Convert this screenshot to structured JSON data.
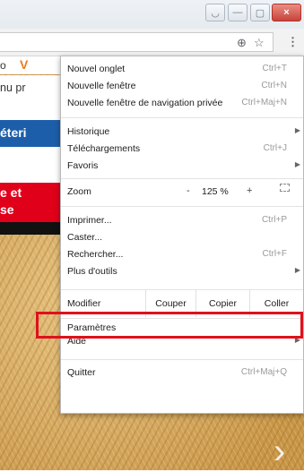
{
  "window": {
    "user_glyph": "◡",
    "min_glyph": "—",
    "max_glyph": "▢",
    "close_glyph": "×"
  },
  "toolbar": {
    "zoom_glyph": "⊕",
    "star_glyph": "☆",
    "menu_glyph": "⋮"
  },
  "page": {
    "bookmark_text": "o",
    "bookmark_icon": "V",
    "snippet": "nu pr",
    "blue_text": "éteri",
    "red_line1": "e et",
    "red_line2": "se",
    "chevron": "›"
  },
  "menu": {
    "new_tab": {
      "label": "Nouvel onglet",
      "shortcut": "Ctrl+T"
    },
    "new_window": {
      "label": "Nouvelle fenêtre",
      "shortcut": "Ctrl+N"
    },
    "new_private": {
      "label": "Nouvelle fenêtre de navigation privée",
      "shortcut": "Ctrl+Maj+N"
    },
    "history": {
      "label": "Historique",
      "arrow": "▶"
    },
    "downloads": {
      "label": "Téléchargements",
      "shortcut": "Ctrl+J"
    },
    "favorites": {
      "label": "Favoris",
      "arrow": "▶"
    },
    "zoom": {
      "label": "Zoom",
      "minus": "-",
      "value": "125 %",
      "plus": "+"
    },
    "print": {
      "label": "Imprimer...",
      "shortcut": "Ctrl+P"
    },
    "cast": {
      "label": "Caster..."
    },
    "find": {
      "label": "Rechercher...",
      "shortcut": "Ctrl+F"
    },
    "more_tools": {
      "label": "Plus d'outils",
      "arrow": "▶"
    },
    "edit": {
      "label": "Modifier",
      "cut": "Couper",
      "copy": "Copier",
      "paste": "Coller"
    },
    "settings": {
      "label": "Paramètres"
    },
    "help": {
      "label": "Aide",
      "arrow": "▶"
    },
    "quit": {
      "label": "Quitter",
      "shortcut": "Ctrl+Maj+Q"
    }
  },
  "colors": {
    "highlight": "#e0101c",
    "blue_band": "#1d5eaa",
    "red_band": "#e0001a"
  }
}
